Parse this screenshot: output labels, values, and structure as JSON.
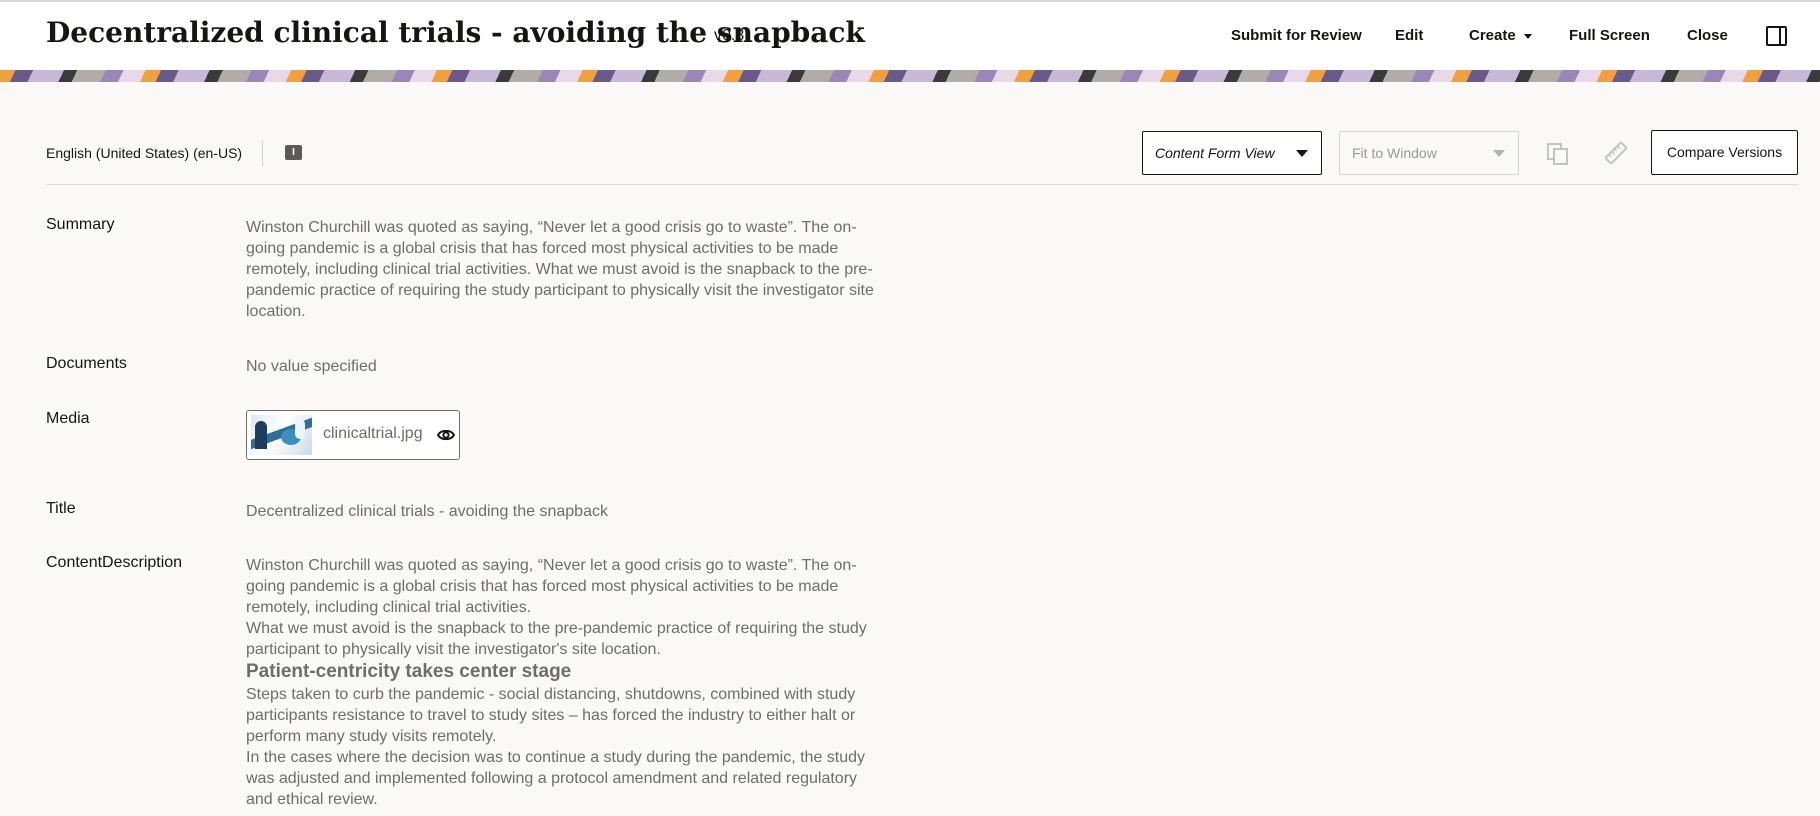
{
  "header": {
    "title": "Decentralized clinical trials - avoiding the snapback",
    "version": "v0.3",
    "actions": {
      "submit": "Submit for Review",
      "edit": "Edit",
      "create": "Create",
      "fullscreen": "Full Screen",
      "close": "Close"
    }
  },
  "toolbar": {
    "language": "English (United States) (en-US)",
    "info_badge": "I",
    "view_select": "Content Form View",
    "fit_select": "Fit to Window",
    "compare": "Compare Versions"
  },
  "fields": {
    "summary": {
      "label": "Summary",
      "value": "Winston Churchill was quoted as saying, “Never let a good crisis go to waste”. The on-going pandemic is a global crisis that has forced most physical activities to be made remotely, including clinical trial activities. What we must avoid is the snapback to the pre-pandemic practice of requiring the study participant to physically visit the investigator site location."
    },
    "documents": {
      "label": "Documents",
      "value": "No value specified"
    },
    "media": {
      "label": "Media",
      "file": "clinicaltrial.jpg"
    },
    "title": {
      "label": "Title",
      "value": "Decentralized clinical trials - avoiding the snapback"
    },
    "description": {
      "label": "ContentDescription",
      "p1": "Winston Churchill was quoted as saying, “Never let a good crisis go to waste”. The on-going pandemic is a global crisis that has forced most physical activities to be made remotely, including clinical trial activities.",
      "p2": "What we must avoid is the snapback to the pre-pandemic practice of requiring the study participant to physically visit the investigator's site location.",
      "heading": "Patient-centricity takes center stage",
      "p3": "Steps taken to curb the pandemic - social distancing, shutdowns, combined with study participants resistance to travel to study sites – has forced the industry to either halt or perform many study visits remotely.",
      "p4": "In the cases where the decision was to continue a study during the pandemic, the study was adjusted and implemented following a protocol amendment and related regulatory and ethical review."
    }
  },
  "icons": {
    "panel": "sidebar-panel-icon",
    "duplicate": "duplicate-icon",
    "ruler": "ruler-icon",
    "eye": "eye-icon"
  }
}
